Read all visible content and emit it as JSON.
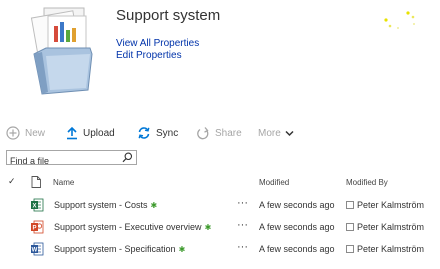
{
  "header": {
    "title": "Support system",
    "links": [
      "View All Properties",
      "Edit Properties"
    ]
  },
  "commands": {
    "new": "New",
    "upload": "Upload",
    "sync": "Sync",
    "share": "Share",
    "more": "More"
  },
  "search": {
    "placeholder": "Find a file"
  },
  "list": {
    "columns": {
      "name": "Name",
      "modified": "Modified",
      "modified_by": "Modified By"
    },
    "rows": [
      {
        "type": "excel-icon",
        "name": "Support system - Costs",
        "new": "✱",
        "actions": "···",
        "modified": "A few seconds ago",
        "modified_by": "Peter Kalmström"
      },
      {
        "type": "powerpoint-icon",
        "name": "Support system - Executive overview",
        "new": "✱",
        "actions": "···",
        "modified": "A few seconds ago",
        "modified_by": "Peter Kalmström"
      },
      {
        "type": "word-icon",
        "name": "Support system - Specification",
        "new": "✱",
        "actions": "···",
        "modified": "A few seconds ago",
        "modified_by": "Peter Kalmström"
      }
    ]
  },
  "colors": {
    "link": "#0033aa",
    "accent": "#0078d7",
    "excel": "#1e7145",
    "powerpoint": "#d24726",
    "word": "#2b579a",
    "new_marker": "#3c9a2c"
  }
}
